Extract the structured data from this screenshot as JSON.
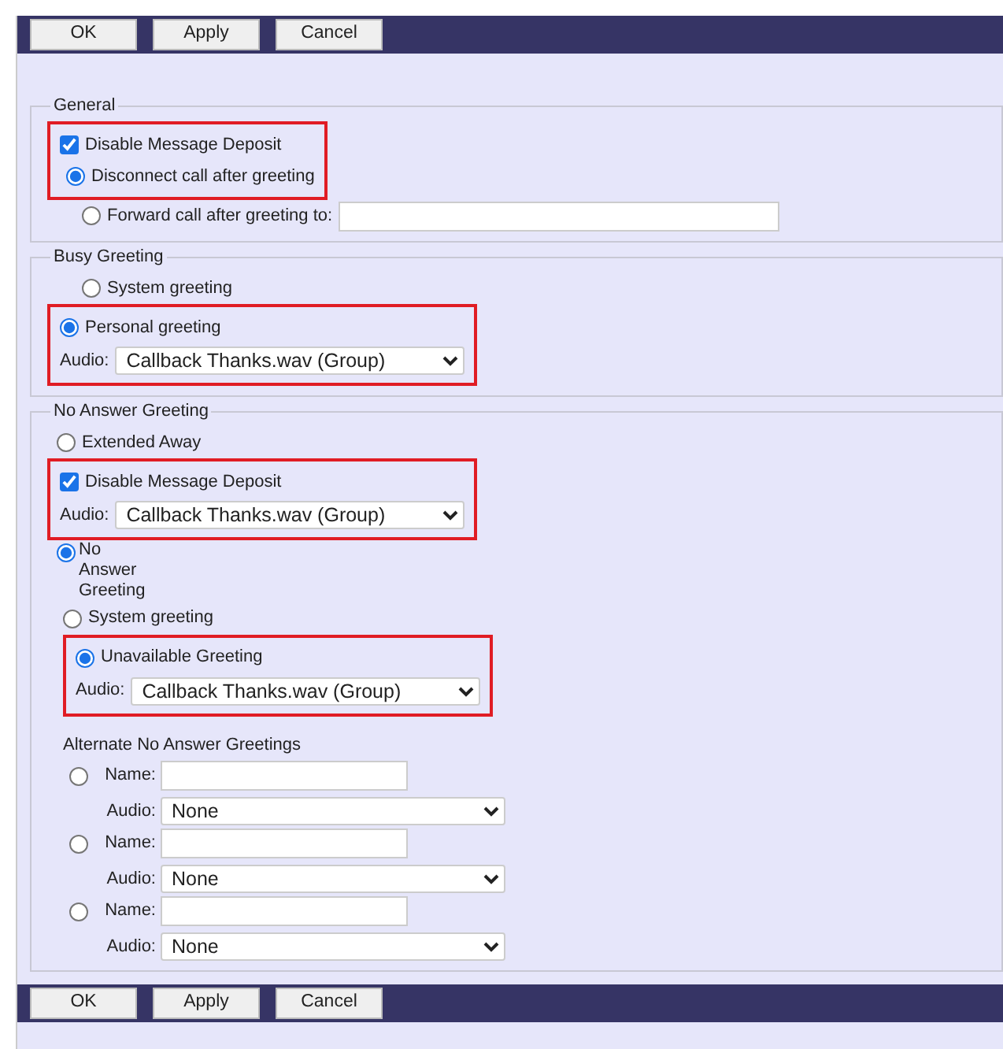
{
  "toolbar_top": {
    "buttons": [
      "OK",
      "Apply",
      "Cancel"
    ]
  },
  "sections": [
    {
      "legend": "General",
      "items": [
        {
          "kind": "highlight",
          "children": [
            {
              "kind": "checkbox",
              "label": "Disable Message Deposit",
              "checked": true,
              "children": [
                {
                  "kind": "radio",
                  "label": "Disconnect call after greeting",
                  "selected": true
                }
              ]
            }
          ]
        },
        {
          "kind": "radio-field",
          "label": "Forward call after greeting to:",
          "selected": false
        }
      ]
    },
    {
      "legend": "Busy Greeting",
      "items": [
        {
          "kind": "radio",
          "label": "System greeting",
          "selected": false
        },
        {
          "kind": "highlight",
          "children": [
            {
              "kind": "radio",
              "label": "Personal greeting",
              "selected": true
            },
            {
              "kind": "select",
              "label": "Audio:",
              "value": "Callback Thanks.wav (Group)"
            }
          ]
        }
      ]
    },
    {
      "legend": "No Answer Greeting",
      "items": [
        {
          "kind": "radio",
          "label": "Extended Away",
          "selected": false,
          "children": [
            {
              "kind": "highlight",
              "children": [
                {
                  "kind": "checkbox",
                  "label": "Disable Message Deposit",
                  "checked": true
                },
                {
                  "kind": "select",
                  "label": "Audio:",
                  "value": "Callback Thanks.wav (Group)"
                }
              ]
            }
          ]
        },
        {
          "kind": "radio-narrow",
          "label": "No Answer Greeting",
          "selected": true,
          "children": [
            {
              "kind": "radio",
              "label": "System greeting",
              "selected": false
            },
            {
              "kind": "highlight",
              "children": [
                {
                  "kind": "radio",
                  "label": "Unavailable Greeting",
                  "selected": true
                },
                {
                  "kind": "select",
                  "label": "Audio:",
                  "value": "Callback Thanks.wav (Group)"
                }
              ]
            },
            {
              "kind": "heading",
              "label": "Alternate No Answer Greetings"
            },
            {
              "kind": "alt-greeting",
              "selected": false,
              "name_label": "Name:",
              "audio_label": "Audio:",
              "audio_value": "None"
            },
            {
              "kind": "alt-greeting",
              "selected": false,
              "name_label": "Name:",
              "audio_label": "Audio:",
              "audio_value": "None"
            },
            {
              "kind": "alt-greeting",
              "selected": false,
              "name_label": "Name:",
              "audio_label": "Audio:",
              "audio_value": "None"
            }
          ]
        }
      ]
    }
  ],
  "toolbar_bottom": {
    "buttons": [
      "OK",
      "Apply",
      "Cancel"
    ]
  }
}
